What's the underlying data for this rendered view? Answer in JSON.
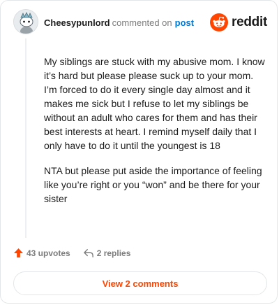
{
  "header": {
    "username": "Cheesypunlord",
    "commented_text": "commented on",
    "post_link": "post",
    "logo_text": "reddit"
  },
  "comment": {
    "paragraphs": [
      "My siblings are stuck with my abusive mom. I know it’s hard but please please suck up to your mom. I’m forced to do it every single day almost and it makes me sick but I refuse to let my siblings be without an adult who cares for them and has their best interests at heart. I remind myself daily that I only have to do it until the youngest is 18",
      "NTA but please put aside the importance of feeling like you’re right or you “won” and be there for your sister"
    ]
  },
  "actions": {
    "upvotes": "43 upvotes",
    "replies": "2 replies"
  },
  "footer": {
    "view_comments": "View 2 comments"
  },
  "colors": {
    "accent": "#ff4500",
    "link": "#0079d3"
  },
  "icons": [
    "avatar-icon",
    "reddit-logo-icon",
    "upvote-arrow-icon",
    "reply-arrow-icon"
  ]
}
